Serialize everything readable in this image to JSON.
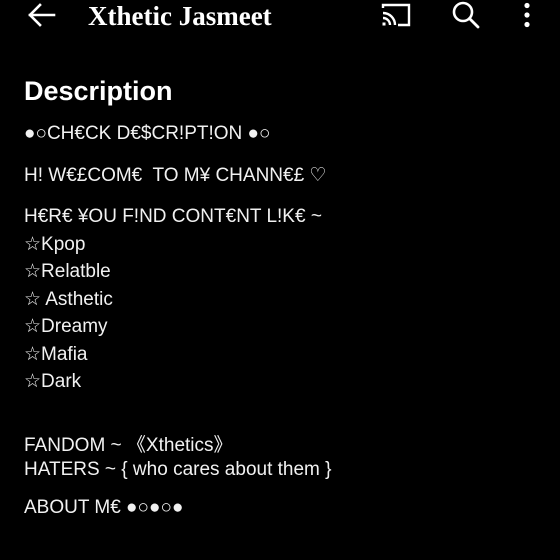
{
  "header": {
    "title": "Xthetic Jasmeet",
    "icons": {
      "back": "arrow-back-icon",
      "cast": "cast-icon",
      "search": "search-icon",
      "more": "more-vert-icon"
    }
  },
  "description": {
    "heading": "Description",
    "lines": {
      "l1": "●○CH€CK D€$CR!PT!ON ●○",
      "l2": "H! W€£COM€  TO M¥ CHANN€£ ♡",
      "l3": "H€R€ ¥OU F!ND CONT€NT L!K€ ~",
      "l4": "☆Kpop",
      "l5": "☆Relatble",
      "l6": "☆ Asthetic",
      "l7": "☆Dreamy",
      "l8": "☆Mafia",
      "l9": "☆Dark",
      "l10": "FANDOM ~ 《Xthetics》",
      "l11": "HATERS ~ { who cares about them }",
      "l12": "ABOUT M€ ●○●○●"
    }
  },
  "colors": {
    "background": "#000000",
    "text": "#ffffff"
  }
}
